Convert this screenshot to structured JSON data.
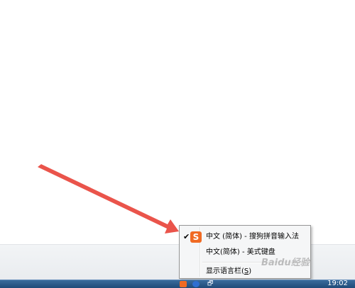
{
  "context_menu": {
    "items": [
      {
        "label": "中文 (简体) - 搜狗拼音输入法",
        "checked": true,
        "icon": "sogou-s-icon"
      },
      {
        "label": "中文(简体) - 美式键盘",
        "checked": false
      },
      {
        "label_prefix": "显示语言栏(",
        "label_key": "S",
        "label_suffix": ")",
        "checked": false
      }
    ],
    "check_mark": "✔",
    "sogou_glyph": "S"
  },
  "taskbar": {
    "clock": "19:02",
    "tray_misc": "🗗"
  },
  "watermark": "Baidu经验",
  "colors": {
    "arrow": "#e8453c",
    "sogou_orange": "#f06a23",
    "taskbar": "#1f4a78"
  }
}
